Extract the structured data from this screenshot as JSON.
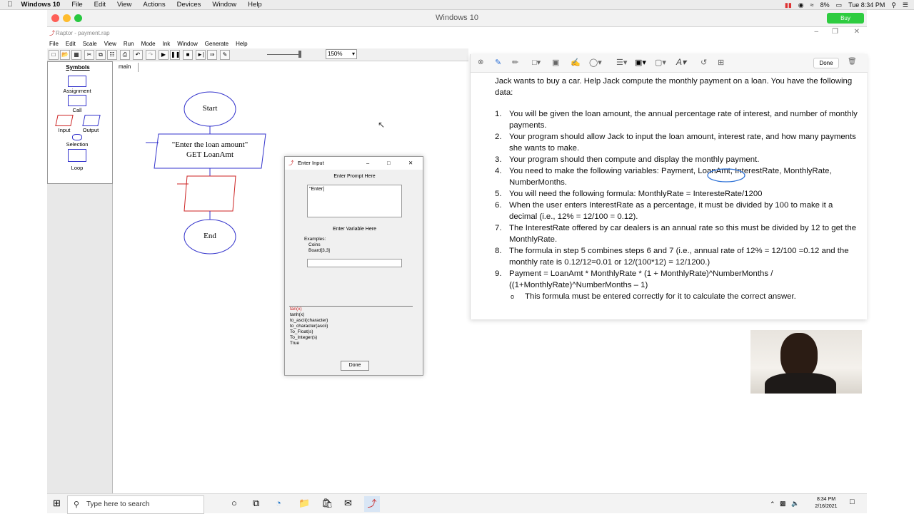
{
  "mac": {
    "app": "Windows 10",
    "menus": [
      "File",
      "Edit",
      "View",
      "Actions",
      "Devices",
      "Window",
      "Help"
    ],
    "battery": "8%",
    "clock": "Tue 8:34 PM"
  },
  "vm": {
    "title": "Windows 10",
    "buy": "Buy"
  },
  "raptor": {
    "title": "Raptor - payment.rap",
    "menus": [
      "File",
      "Edit",
      "Scale",
      "View",
      "Run",
      "Mode",
      "Ink",
      "Window",
      "Generate",
      "Help"
    ],
    "zoom": "150%",
    "tab": "main",
    "symbols_title": "Symbols",
    "symbols": {
      "assignment": "Assignment",
      "call": "Call",
      "input": "Input",
      "output": "Output",
      "selection": "Selection",
      "loop": "Loop"
    },
    "flow": {
      "start": "Start",
      "input_line1": "\"Enter the loan amount\"",
      "input_line2": "GET LoanAmt",
      "end": "End"
    }
  },
  "dialog": {
    "title": "Enter Input",
    "prompt_label": "Enter Prompt Here",
    "prompt_value": "\"Enter|",
    "variable_label": "Enter Variable Here",
    "examples_label": "Examples:",
    "examples": [
      "Coins",
      "Board[3,3]"
    ],
    "functions": [
      "tan(x)",
      "tanh(x)",
      "to_ascii(character)",
      "to_character(ascii)",
      "To_Float(s)",
      "To_Integer(s)",
      "True"
    ],
    "done": "Done"
  },
  "doc": {
    "done": "Done",
    "intro": "Jack wants to buy a car.  Help Jack compute the monthly payment on a loan.  You have the following data:",
    "items": [
      "You will be given the loan amount, the annual percentage rate of interest, and number of monthly payments.",
      "Your program should allow Jack to input the loan amount, interest rate, and how many payments she wants to make.",
      "Your program should then compute and display the monthly payment.",
      "You need to make the following variables: Payment, LoanAmt, InterestRate, MonthlyRate, NumberMonths.",
      "You will need the following formula: MonthlyRate = InteresteRate/1200",
      "When the user enters InterestRate as a percentage, it must be divided by 100 to make it a decimal (i.e., 12% = 12/100 = 0.12).",
      "The InterestRate offered by car dealers is an annual rate so this must be divided by 12 to get the MonthlyRate.",
      "The formula in step 5 combines steps 6 and 7 (i.e., annual rate of 12% = 12/100 =0.12 and the monthly rate is 0.12/12=0.01 or 12/(100*12) = 12/1200.)",
      "Payment = LoanAmt * MonthlyRate * (1 + MonthlyRate)^NumberMonths / ((1+MonthlyRate)^NumberMonths – 1)"
    ],
    "subitem": "This formula must be entered correctly for it to calculate the correct answer."
  },
  "taskbar": {
    "search_placeholder": "Type here to search",
    "time": "8:34 PM",
    "date": "2/16/2021"
  }
}
